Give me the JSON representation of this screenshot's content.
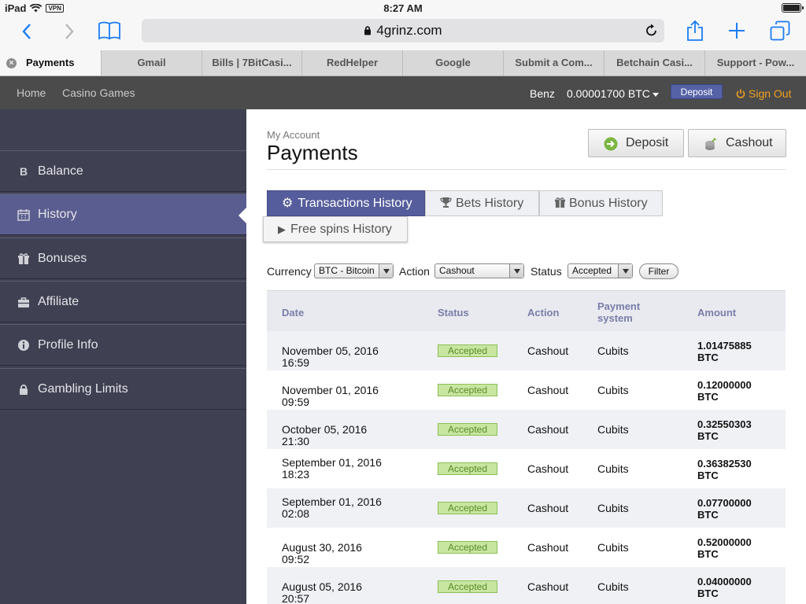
{
  "status_bar": {
    "device": "iPad",
    "vpn": "VPN",
    "time": "8:27 AM"
  },
  "browser": {
    "url": "4grinz.com",
    "tabs": [
      {
        "label": "Payments",
        "active": true
      },
      {
        "label": "Gmail"
      },
      {
        "label": "Bills | 7BitCasi..."
      },
      {
        "label": "RedHelper"
      },
      {
        "label": "Google"
      },
      {
        "label": "Submit a Com..."
      },
      {
        "label": "Betchain Casi..."
      },
      {
        "label": "Support - Pow..."
      }
    ]
  },
  "site_header": {
    "nav": [
      "Home",
      "Casino Games"
    ],
    "username": "Benz",
    "balance": "0.00001700 BTC",
    "deposit_label": "Deposit",
    "signout_label": "Sign Out"
  },
  "sidebar": {
    "items": [
      {
        "label": "Balance",
        "icon": "bitcoin-icon"
      },
      {
        "label": "History",
        "icon": "calendar-icon",
        "active": true
      },
      {
        "label": "Bonuses",
        "icon": "gift-icon"
      },
      {
        "label": "Affiliate",
        "icon": "briefcase-icon"
      },
      {
        "label": "Profile Info",
        "icon": "info-icon"
      },
      {
        "label": "Gambling Limits",
        "icon": "lock-icon"
      }
    ]
  },
  "page": {
    "breadcrumb": "My Account",
    "title": "Payments",
    "deposit_button": "Deposit",
    "cashout_button": "Cashout"
  },
  "history_tabs": [
    {
      "label": "Transactions History",
      "icon": "gear-icon",
      "active": true
    },
    {
      "label": "Bets History",
      "icon": "trophy-icon"
    },
    {
      "label": "Bonus History",
      "icon": "gift-icon"
    },
    {
      "label": "Free spins History",
      "icon": "play-icon"
    }
  ],
  "filters": {
    "currency_label": "Currency",
    "currency_value": "BTC - Bitcoin",
    "action_label": "Action",
    "action_value": "Cashout",
    "status_label": "Status",
    "status_value": "Accepted",
    "filter_button": "Filter"
  },
  "table": {
    "columns": [
      "Date",
      "Status",
      "Action",
      "Payment system",
      "Amount"
    ],
    "rows": [
      {
        "date": "November 05, 2016 16:59",
        "status": "Accepted",
        "action": "Cashout",
        "system": "Cubits",
        "amount": "1.01475885 BTC"
      },
      {
        "date": "November 01, 2016 09:59",
        "status": "Accepted",
        "action": "Cashout",
        "system": "Cubits",
        "amount": "0.12000000 BTC"
      },
      {
        "date": "October 05, 2016 21:30",
        "status": "Accepted",
        "action": "Cashout",
        "system": "Cubits",
        "amount": "0.32550303 BTC"
      },
      {
        "date": "September 01, 2016 18:23",
        "status": "Accepted",
        "action": "Cashout",
        "system": "Cubits",
        "amount": "0.36382530 BTC"
      },
      {
        "date": "September 01, 2016 02:08",
        "status": "Accepted",
        "action": "Cashout",
        "system": "Cubits",
        "amount": "0.07700000 BTC"
      },
      {
        "date": "August 30, 2016 09:52",
        "status": "Accepted",
        "action": "Cashout",
        "system": "Cubits",
        "amount": "0.52000000 BTC"
      },
      {
        "date": "August 05, 2016 20:57",
        "status": "Accepted",
        "action": "Cashout",
        "system": "Cubits",
        "amount": "0.04000000 BTC"
      }
    ]
  },
  "colors": {
    "sidebar_bg": "#3f4051",
    "sidebar_active": "#5a5d8f",
    "header_bg": "#4b4b4b",
    "accent": "#565d9c",
    "signout": "#f0a020",
    "badge_bg": "#c8e6a0",
    "safari_blue": "#1a7cf5"
  }
}
